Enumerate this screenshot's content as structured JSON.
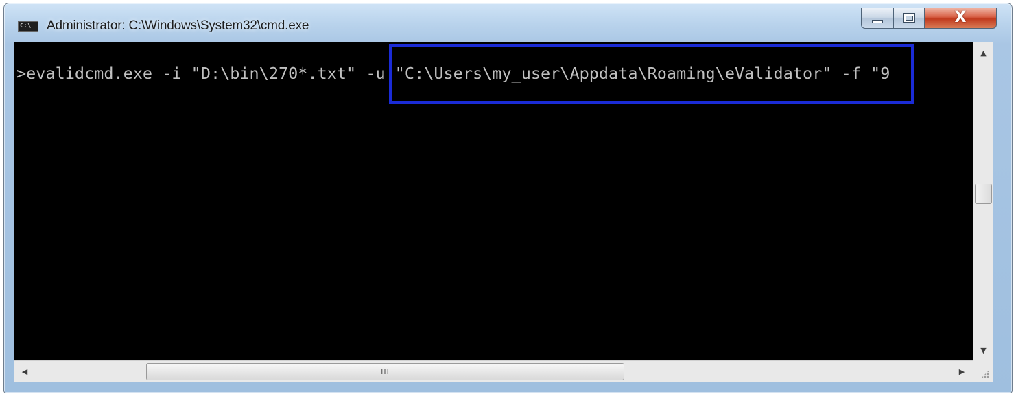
{
  "window": {
    "title": "Administrator: C:\\Windows\\System32\\cmd.exe",
    "app_icon_text": "C:\\",
    "controls": {
      "minimize_icon": "minimize-icon",
      "maximize_icon": "maximize-icon",
      "close_icon": "close-icon",
      "close_glyph": "X"
    }
  },
  "console": {
    "command_line": ">evalidcmd.exe -i \"D:\\bin\\270*.txt\" -u \"C:\\Users\\my_user\\Appdata\\Roaming\\eValidator\" -f \"9",
    "highlight_color": "#1a2bd6",
    "background": "#000000",
    "text_color": "#c0c0c0"
  },
  "scrollbars": {
    "up_arrow": "▲",
    "down_arrow": "▼",
    "left_arrow": "◀",
    "right_arrow": "▶",
    "thumb_grip": "III"
  }
}
